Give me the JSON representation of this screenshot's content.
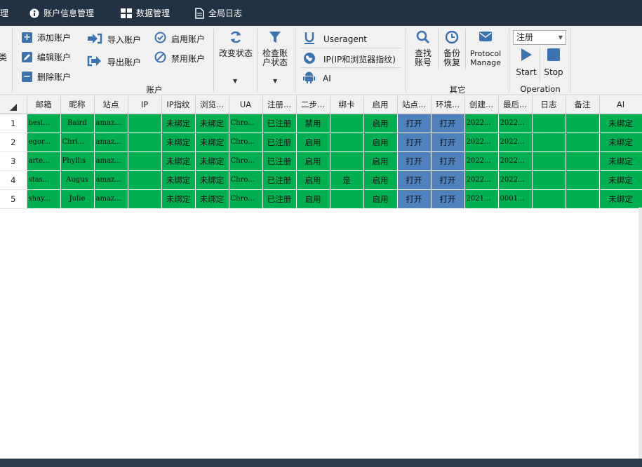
{
  "tabs": [
    {
      "label": "理"
    },
    {
      "label": "账户信息管理"
    },
    {
      "label": "数据管理"
    },
    {
      "label": "全局日志"
    }
  ],
  "ribbon": {
    "left_stub": "类",
    "account_group": {
      "label": "账户",
      "add": "添加账户",
      "edit": "编辑账户",
      "delete": "删除账户",
      "import": "导入账户",
      "export": "导出账户",
      "enable": "启用账户",
      "disable": "禁用账户",
      "change_status": "改变状态",
      "check_status_line1": "检查账",
      "check_status_line2": "户状态"
    },
    "useragent": "Useragent",
    "fingerprint": "IP(IP和浏览器指纹)",
    "ai": "AI",
    "other_group": {
      "label": "其它",
      "find_line1": "查找",
      "find_line2": "账号",
      "backup_line1": "备份",
      "backup_line2": "恢复",
      "protocol_line1": "Protocol",
      "protocol_line2": "Manage"
    },
    "operation_group": {
      "label": "Operation",
      "select_value": "注册",
      "start": "Start",
      "stop": "Stop"
    }
  },
  "grid": {
    "columns": [
      "邮箱",
      "昵称",
      "站点",
      "IP",
      "IP指纹",
      "浏览...",
      "UA",
      "注册...",
      "二步...",
      "绑卡",
      "启用",
      "站点...",
      "环境...",
      "创建...",
      "最后...",
      "日志",
      "备注",
      "AI"
    ],
    "rows": [
      {
        "num": "1",
        "email": "besl...",
        "nick": "Baird",
        "site": "amaz...",
        "ip": "",
        "ipfp": "未绑定",
        "browser": "未绑定",
        "ua": "Chro...",
        "reg": "已注册",
        "twostep": "禁用",
        "card": "",
        "enabled": "启用",
        "site_open": "打开",
        "env": "打开",
        "created": "2022...",
        "last": "2022...",
        "log": "",
        "note": "",
        "ai": "未绑定"
      },
      {
        "num": "2",
        "email": "egor...",
        "nick": "Chri...",
        "site": "amaz...",
        "ip": "",
        "ipfp": "未绑定",
        "browser": "未绑定",
        "ua": "Chro...",
        "reg": "已注册",
        "twostep": "启用",
        "card": "",
        "enabled": "启用",
        "site_open": "打开",
        "env": "打开",
        "created": "2022...",
        "last": "2022...",
        "log": "",
        "note": "",
        "ai": "未绑定"
      },
      {
        "num": "3",
        "email": "arte...",
        "nick": "Phyllis",
        "site": "amaz...",
        "ip": "",
        "ipfp": "未绑定",
        "browser": "未绑定",
        "ua": "Chro...",
        "reg": "已注册",
        "twostep": "启用",
        "card": "",
        "enabled": "启用",
        "site_open": "打开",
        "env": "打开",
        "created": "2022...",
        "last": "2022...",
        "log": "",
        "note": "",
        "ai": "未绑定"
      },
      {
        "num": "4",
        "email": "stas...",
        "nick": "Augus",
        "site": "amaz...",
        "ip": "",
        "ipfp": "未绑定",
        "browser": "未绑定",
        "ua": "Chro...",
        "reg": "已注册",
        "twostep": "启用",
        "card": "是",
        "enabled": "启用",
        "site_open": "打开",
        "env": "打开",
        "created": "2022...",
        "last": "2022...",
        "log": "",
        "note": "",
        "ai": "未绑定"
      },
      {
        "num": "5",
        "email": "shay...",
        "nick": "Julie",
        "site": "amaz...",
        "ip": "",
        "ipfp": "未绑定",
        "browser": "未绑定",
        "ua": "Chro...",
        "reg": "已注册",
        "twostep": "启用",
        "card": "",
        "enabled": "启用",
        "site_open": "打开",
        "env": "打开",
        "created": "2021...",
        "last": "0001...",
        "log": "",
        "note": "",
        "ai": "未绑定"
      }
    ]
  },
  "colors": {
    "titlebar": "#233242",
    "row_green": "#00b050",
    "cell_blue": "#4f81bd",
    "icon_blue": "#3a73b0"
  }
}
